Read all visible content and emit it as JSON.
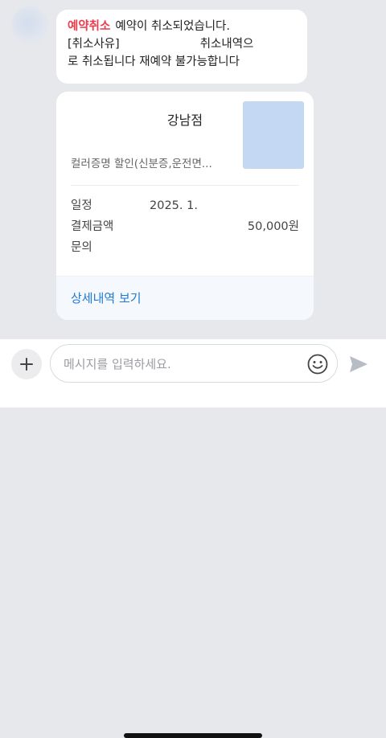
{
  "message": {
    "tag": "예약취소",
    "line1_text": "예약이 취소되었습니다.",
    "line2_left": "[취소사유]",
    "line2_right": "취소내역으",
    "line3": "로 취소됩니다 재예약 불가능합니다"
  },
  "card": {
    "title": "강남점",
    "product": "컬러증명 할인(신분증,운전면...",
    "rows": [
      {
        "label": "일정",
        "value": "2025. 1.",
        "align": "left"
      },
      {
        "label": "결제금액",
        "value": "50,000원",
        "align": "right"
      },
      {
        "label": "문의",
        "value": "",
        "align": "left"
      }
    ],
    "detail_link": "상세내역 보기"
  },
  "input": {
    "placeholder": "메시지를 입력하세요."
  },
  "icons": {
    "plus": "plus-icon",
    "emoji": "smiley-icon",
    "send": "send-icon"
  },
  "colors": {
    "tag_red": "#ec3b4b",
    "link_blue": "#1f7ad1",
    "chat_bg": "#e6e8eb"
  }
}
